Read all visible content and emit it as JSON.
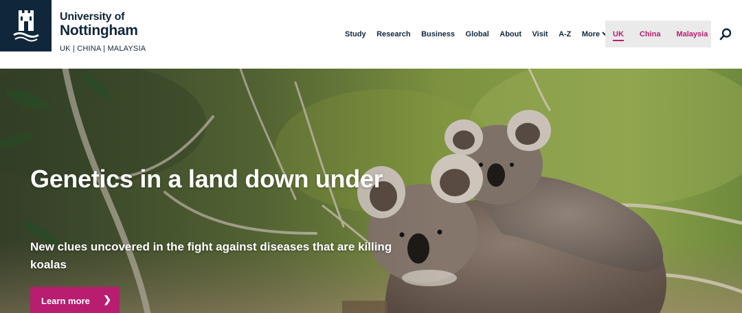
{
  "brand": {
    "line1": "University of",
    "line2": "Nottingham",
    "campuses": "UK | CHINA | MALAYSIA",
    "crest_color": "#10263b"
  },
  "nav": {
    "items": [
      "Study",
      "Research",
      "Business",
      "Global",
      "About",
      "Visit",
      "A-Z"
    ],
    "more_label": "More",
    "text_color": "#10263b"
  },
  "campus_switcher": {
    "items": [
      "UK",
      "China",
      "Malaysia"
    ],
    "active": "UK",
    "accent": "#b81d6f"
  },
  "search": {
    "icon": "search-icon"
  },
  "hero": {
    "title": "Genetics in a land down under",
    "subtitle": "New clues uncovered in the fight against diseases that are killing koalas",
    "cta_label": "Learn more",
    "cta_icon": "chevron-right-icon",
    "cta_color": "#b81d6f",
    "image": "koala-photo"
  }
}
